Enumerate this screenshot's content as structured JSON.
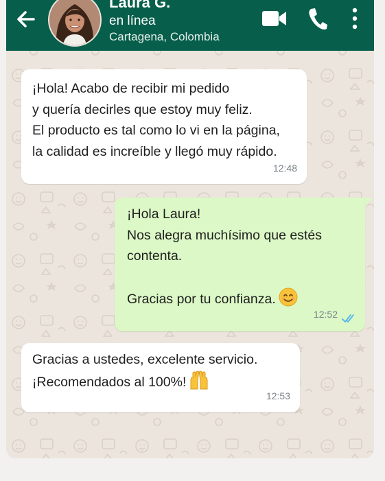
{
  "header": {
    "contact_name": "Laura G.",
    "status": "en línea",
    "location": "Cartagena, Colombia"
  },
  "messages": [
    {
      "direction": "incoming",
      "lines": [
        "¡Hola! Acabo de recibir mi pedido",
        "y quería decirles que estoy muy feliz.",
        "El producto es tal como lo vi en la página,",
        "la calidad es increíble y llegó muy rápido."
      ],
      "time": "12:48"
    },
    {
      "direction": "outgoing",
      "lines": [
        "¡Hola Laura!",
        "Nos alegra muchísimo que estés",
        "contenta.",
        "",
        "Gracias por tu confianza."
      ],
      "emoji": "smiling-face-emoji",
      "time": "12:52",
      "read": true
    },
    {
      "direction": "incoming",
      "lines": [
        "Gracias a ustedes, excelente servicio.",
        "¡Recomendados al 100%!"
      ],
      "emoji": "raised-hands-emoji",
      "time": "12:53"
    }
  ],
  "colors": {
    "header": "#075e4b",
    "chat_background": "#ece5dd",
    "incoming_bubble": "#ffffff",
    "outgoing_bubble": "#dcf8c6",
    "read_ticks": "#4fb6ec"
  },
  "icons": [
    "back-arrow-icon",
    "video-call-icon",
    "phone-icon",
    "more-vertical-icon"
  ]
}
